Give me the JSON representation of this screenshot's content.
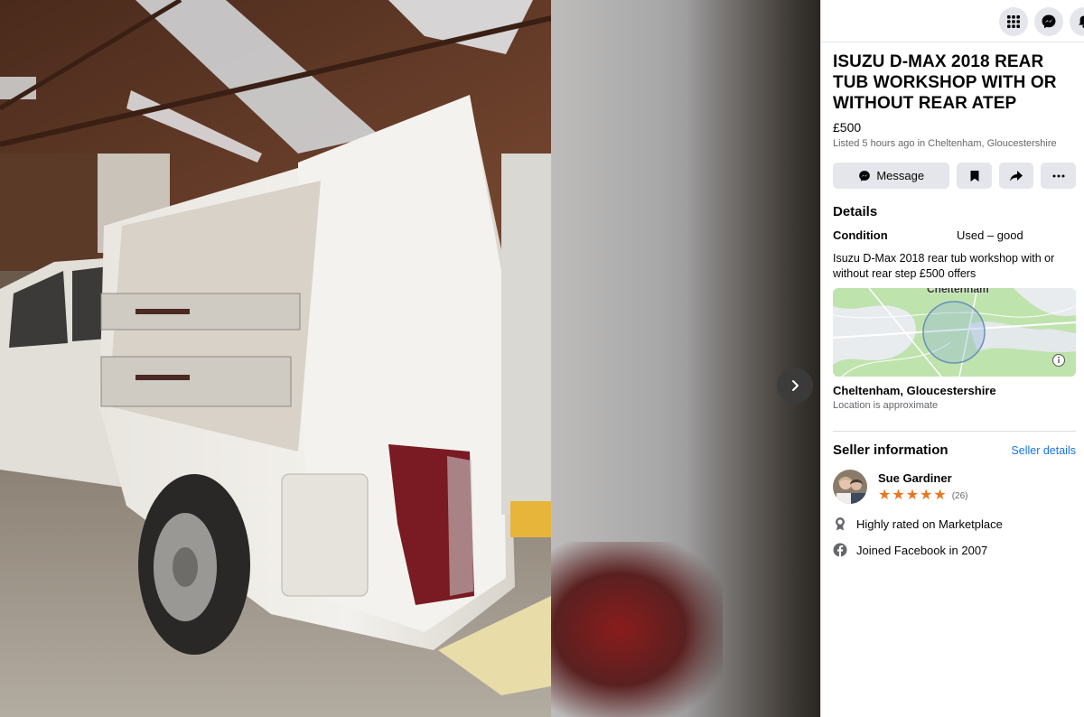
{
  "header": {
    "icons": [
      "menu-grid-icon",
      "messenger-icon",
      "notifications-icon"
    ]
  },
  "listing": {
    "title": "ISUZU D-MAX 2018 REAR TUB WORKSHOP WITH OR WITHOUT REAR ATEP",
    "price": "£500",
    "listed": "Listed 5 hours ago in Cheltenham, Gloucestershire"
  },
  "actions": {
    "message_label": "Message"
  },
  "details": {
    "heading": "Details",
    "condition_label": "Condition",
    "condition_value": "Used – good",
    "description": "Isuzu D-Max 2018 rear tub workshop with or without rear step £500 offers"
  },
  "map": {
    "place_label": "Cheltenham"
  },
  "location": {
    "name": "Cheltenham, Gloucestershire",
    "note": "Location is approximate"
  },
  "seller": {
    "heading": "Seller information",
    "details_link": "Seller details",
    "name": "Sue Gardiner",
    "rating": 5,
    "rating_count": "(26)",
    "facts": [
      {
        "icon": "badge-icon",
        "text": "Highly rated on Marketplace"
      },
      {
        "icon": "facebook-icon",
        "text": "Joined Facebook in 2007"
      }
    ]
  },
  "colors": {
    "accent_link": "#1a73e8",
    "star": "#e87722",
    "button_bg": "#e4e6eb"
  }
}
